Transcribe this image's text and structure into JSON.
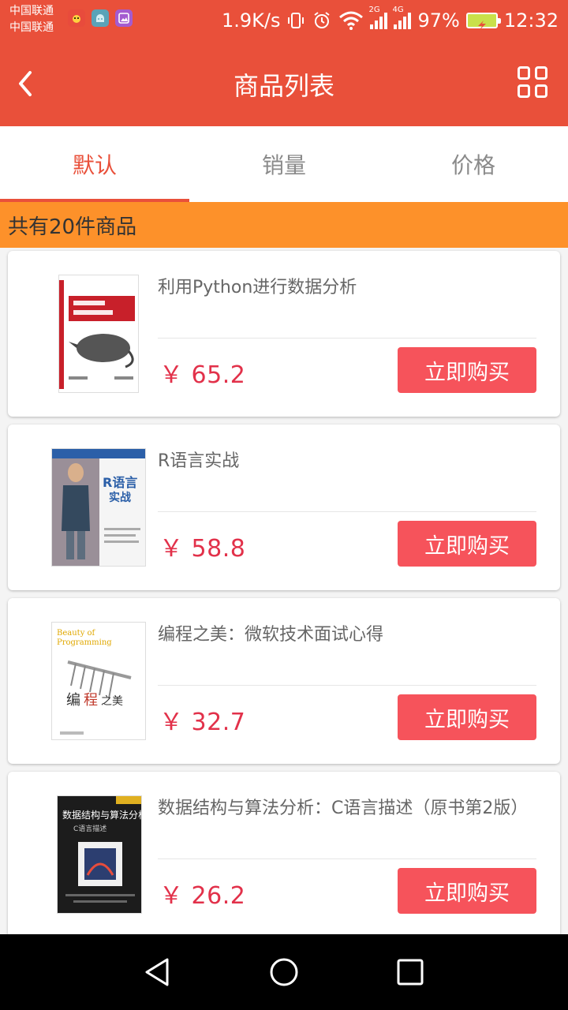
{
  "status_bar": {
    "carrier_1": "中国联通",
    "carrier_2": "中国联通",
    "speed": "1.9K/s",
    "sig1_label": "2G",
    "sig2_label": "4G",
    "battery": "97%",
    "time": "12:32"
  },
  "header": {
    "title": "商品列表",
    "back_icon": "chevron-left-icon",
    "layout_icon": "grid-view-icon"
  },
  "tabs": [
    {
      "label": "默认",
      "active": true
    },
    {
      "label": "销量",
      "active": false
    },
    {
      "label": "价格",
      "active": false
    }
  ],
  "count_text": "共有20件商品",
  "products": [
    {
      "title": "利用Python进行数据分析",
      "price": "￥ 65.2",
      "button": "立即购买"
    },
    {
      "title": "R语言实战",
      "price": "￥ 58.8",
      "button": "立即购买"
    },
    {
      "title": "编程之美：微软技术面试心得",
      "price": "￥ 32.7",
      "button": "立即购买"
    },
    {
      "title": "数据结构与算法分析：C语言描述（原书第2版）",
      "price": "￥ 26.2",
      "button": "立即购买"
    }
  ],
  "colors": {
    "primary": "#e9503a",
    "orange_bar": "#fd912a",
    "price": "#e2314a",
    "button": "#f6535b"
  }
}
